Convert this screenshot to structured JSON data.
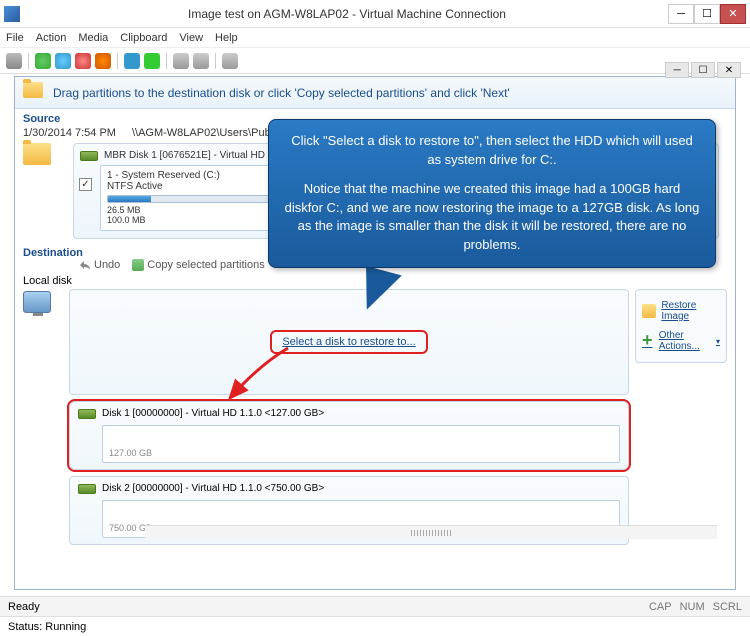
{
  "window": {
    "title": "Image test on AGM-W8LAP02 - Virtual Machine Connection"
  },
  "menu": {
    "file": "File",
    "action": "Action",
    "media": "Media",
    "clipboard": "Clipboard",
    "view": "View",
    "help": "Help"
  },
  "header": {
    "instruction": "Drag partitions to the destination disk or click 'Copy selected partitions' and click 'Next'"
  },
  "source": {
    "label": "Source",
    "timestamp": "1/30/2014 7:54 PM",
    "path": "\\\\AGM-W8LAP02\\Users\\Public\\Downloa",
    "disk_label": "MBR Disk 1 [0676521E] - Virtual HD 1.1.0  <100.00",
    "partition": {
      "name": "1 - System Reserved (C:)",
      "fs": "NTFS Active",
      "used": "26.5 MB",
      "total": "100.0 MB"
    }
  },
  "destination": {
    "label": "Destination",
    "local": "Local disk",
    "undo": "Undo",
    "copy": "Copy selected partitions",
    "select_text": "Select a disk to restore to...",
    "disks": [
      {
        "label": "Disk 1 [00000000] - Virtual HD 1.1.0  <127.00 GB>",
        "size": "127.00 GB"
      },
      {
        "label": "Disk 2 [00000000] - Virtual HD 1.1.0  <750.00 GB>",
        "size": "750.00 GB"
      }
    ]
  },
  "side": {
    "restore": "Restore Image",
    "other": "Other Actions..."
  },
  "callout": {
    "p1": "Click \"Select a disk to restore to\", then select the HDD which will used as system drive for C:.",
    "p2": "Notice that the machine we created this image had a 100GB  hard diskfor C:, and we are now restoring the image to a 127GB disk. As long as the image is smaller than the disk it will be restored, there are no problems."
  },
  "status": {
    "ready": "Ready",
    "cap": "CAP",
    "num": "NUM",
    "scrl": "SCRL",
    "running": "Status: Running"
  }
}
